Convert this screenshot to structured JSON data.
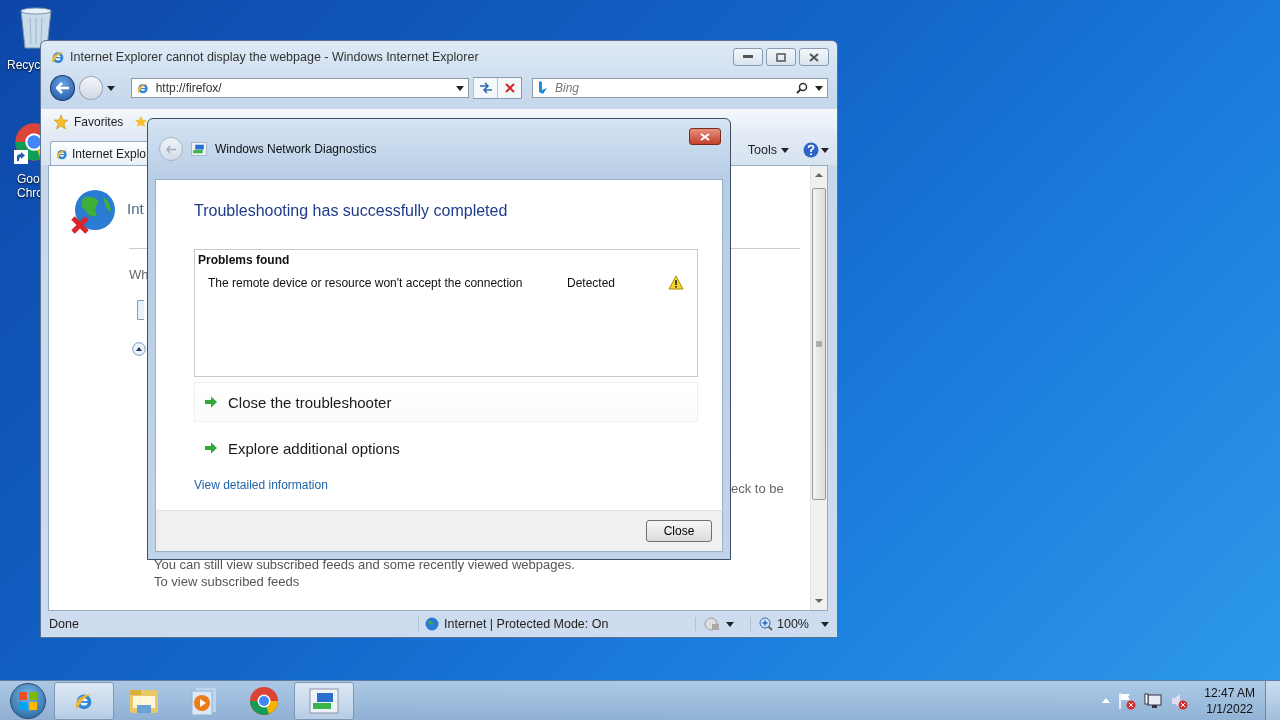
{
  "desktop_icons": [
    {
      "kind": "recycle",
      "lines": [
        "Recyc"
      ]
    },
    {
      "kind": "chrome",
      "lines": [
        "Goo",
        "Chrc"
      ]
    }
  ],
  "browser": {
    "title": "Internet Explorer cannot display the webpage - Windows Internet Explorer",
    "address": "http://firefox/",
    "search_placeholder": "Bing",
    "favorites": "Favorites",
    "tab": "Internet Explo",
    "tools": "Tools",
    "page": {
      "heading": "Int",
      "line_1": "Wh",
      "cut_text": "eck to be",
      "feeds_lines": [
        "You can still view subscribed feeds and some recently viewed webpages.",
        "To view subscribed feeds"
      ]
    },
    "status": {
      "text": "Done",
      "zone": "Internet | Protected Mode: On",
      "zoom": "100%"
    }
  },
  "dialog": {
    "title": "Windows Network Diagnostics",
    "heading": "Troubleshooting has successfully completed",
    "problems_header": "Problems found",
    "problems": [
      {
        "text": "The remote device or resource won't accept the connection",
        "status": "Detected"
      }
    ],
    "options": [
      {
        "label": "Close the troubleshooter",
        "selected": true
      },
      {
        "label": "Explore additional options",
        "selected": false
      }
    ],
    "link": "View detailed information",
    "button": "Close"
  },
  "taskbar": {
    "items": [
      {
        "kind": "ie",
        "selected": true
      },
      {
        "kind": "folder",
        "selected": false
      },
      {
        "kind": "media",
        "selected": false
      },
      {
        "kind": "chrome",
        "selected": false
      },
      {
        "kind": "network",
        "selected": true
      }
    ],
    "clock": {
      "time": "12:47 AM",
      "date": "1/1/2022"
    }
  }
}
